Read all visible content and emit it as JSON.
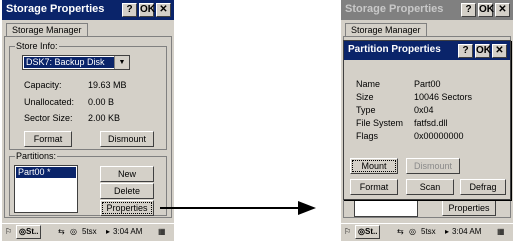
{
  "left": {
    "title": "Storage Properties",
    "help": "?",
    "ok": "OK",
    "close": "✕",
    "tab": "Storage Manager",
    "store_info_label": "Store Info:",
    "store_selected": "DSK7: Backup Disk",
    "capacity_label": "Capacity:",
    "capacity_value": "19.63 MB",
    "unallocated_label": "Unallocated:",
    "unallocated_value": "0.00 B",
    "sector_label": "Sector Size:",
    "sector_value": "2.00 KB",
    "format_button": "Format",
    "dismount_button": "Dismount",
    "partitions_label": "Partitions:",
    "partition_item": "Part00 *",
    "new_button": "New",
    "delete_button": "Delete",
    "properties_button": "Properties"
  },
  "right": {
    "title_bg": "Storage Properties",
    "tab": "Storage Manager",
    "dialog_title": "Partition Properties",
    "help": "?",
    "ok": "OK",
    "close": "✕",
    "props": [
      {
        "label": "Name",
        "value": "Part00"
      },
      {
        "label": "Size",
        "value": "10046 Sectors"
      },
      {
        "label": "Type",
        "value": "0x04"
      },
      {
        "label": "File System",
        "value": "fatfsd.dll"
      },
      {
        "label": "Flags",
        "value": "0x00000000"
      }
    ],
    "mount_button": "Mount",
    "dismount_button": "Dismount",
    "format_button": "Format",
    "scan_button": "Scan",
    "defrag_button": "Defrag",
    "properties_button_bg": "Properties"
  },
  "taskbar": {
    "start": "St..",
    "task_icon_label": "5tsx",
    "time": "3:04 AM"
  }
}
